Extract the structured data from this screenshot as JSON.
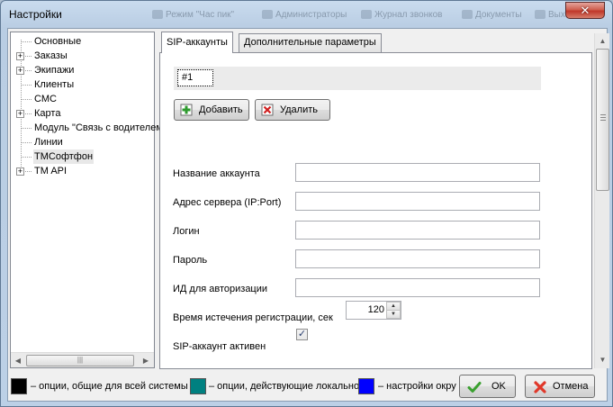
{
  "window": {
    "title": "Настройки",
    "close_glyph": "✕",
    "background_toolbar": [
      "Режим \"Час пик\"",
      "Администраторы",
      "Журнал звонков",
      "Документы",
      "Выход"
    ]
  },
  "tree": {
    "items": [
      {
        "label": "Основные",
        "expandable": false
      },
      {
        "label": "Заказы",
        "expandable": true
      },
      {
        "label": "Экипажи",
        "expandable": true
      },
      {
        "label": "Клиенты",
        "expandable": false
      },
      {
        "label": "СМС",
        "expandable": false
      },
      {
        "label": "Карта",
        "expandable": true
      },
      {
        "label": "Модуль \"Связь с водителем\"",
        "expandable": false
      },
      {
        "label": "Линии",
        "expandable": false
      },
      {
        "label": "TMСофтфон",
        "expandable": false,
        "selected": true
      },
      {
        "label": "TM API",
        "expandable": true
      }
    ],
    "expand_glyph": "+"
  },
  "tabs": [
    {
      "label": "SIP-аккаунты",
      "active": true
    },
    {
      "label": "Дополнительные параметры",
      "active": false
    }
  ],
  "account": {
    "current": "#1",
    "add_label": "Добавить",
    "delete_label": "Удалить"
  },
  "form": {
    "account_name_label": "Название аккаунта",
    "account_name_value": "",
    "server_address_label": "Адрес сервера (IP:Port)",
    "server_address_value": "",
    "login_label": "Логин",
    "login_value": "",
    "password_label": "Пароль",
    "password_value": "",
    "auth_id_label": "ИД для авторизации",
    "auth_id_value": "",
    "expiration_label": "Время истечения регистрации, сек",
    "expiration_value": "120",
    "active_label": "SIP-аккаунт активен",
    "active_checked": true
  },
  "legend": {
    "items": [
      {
        "color": "#000000",
        "text": "– опции, общие для всей системы"
      },
      {
        "color": "#008080",
        "text": "– опции, действующие локально"
      },
      {
        "color": "#0000ff",
        "text": "– настройки окружения"
      }
    ]
  },
  "buttons": {
    "ok_label": "OK",
    "cancel_label": "Отмена"
  }
}
